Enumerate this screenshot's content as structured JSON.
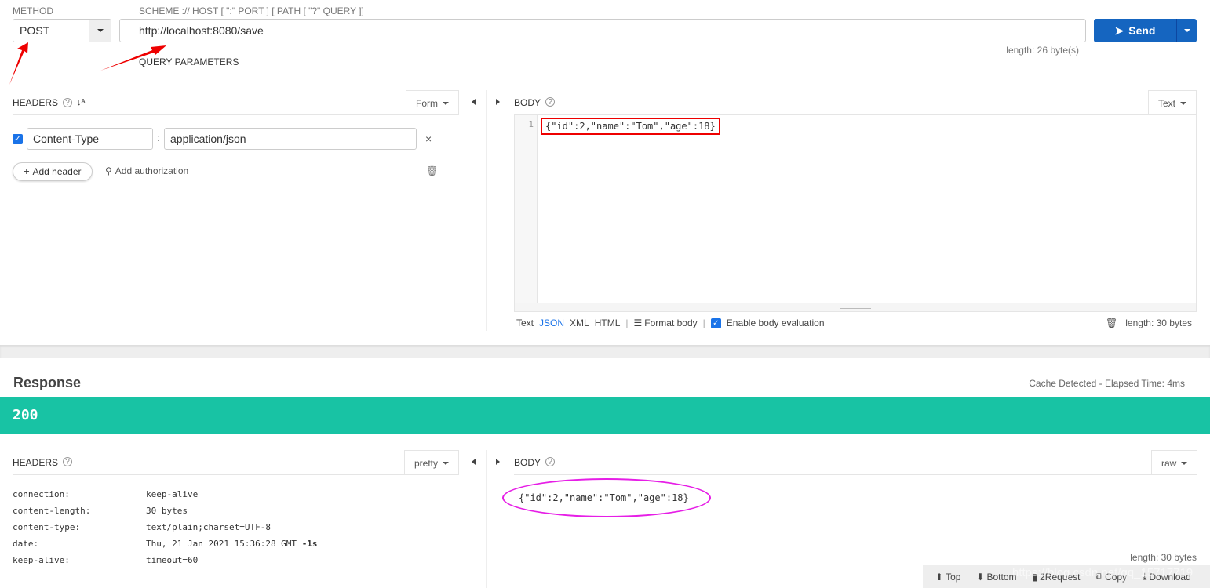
{
  "request": {
    "method_label": "METHOD",
    "method": "POST",
    "url_label": "SCHEME :// HOST [ \":\" PORT ] [ PATH [ \"?\" QUERY ]]",
    "url": "http://localhost:8080/save",
    "send_label": "Send",
    "url_length": "length: 26 byte(s)",
    "query_params": "QUERY PARAMETERS"
  },
  "req_headers": {
    "title": "HEADERS",
    "mode": "Form",
    "rows": [
      {
        "name": "Content-Type",
        "value": "application/json",
        "checked": true
      }
    ],
    "add_header": "Add header",
    "add_auth": "Add authorization"
  },
  "req_body": {
    "title": "BODY",
    "mode": "Text",
    "line_no": "1",
    "content": "{\"id\":2,\"name\":\"Tom\",\"age\":18}",
    "formats": [
      "Text",
      "JSON",
      "XML",
      "HTML"
    ],
    "format_body": "Format body",
    "enable_eval": "Enable body evaluation",
    "length": "length: 30 bytes"
  },
  "response": {
    "title": "Response",
    "elapsed": "Cache Detected - Elapsed Time: 4ms",
    "status": "200",
    "status_color": "#18c3a4",
    "headers_title": "HEADERS",
    "headers_mode": "pretty",
    "headers": [
      {
        "k": "connection:",
        "v": "keep-alive"
      },
      {
        "k": "content-length:",
        "v": "30 bytes"
      },
      {
        "k": "content-type:",
        "v": "text/plain;charset=UTF-8"
      },
      {
        "k": "date:",
        "v": "Thu, 21 Jan 2021 15:36:28 GMT",
        "extra": "-1s"
      },
      {
        "k": "keep-alive:",
        "v": "timeout=60"
      }
    ],
    "body_title": "BODY",
    "body_mode": "raw",
    "body": "{\"id\":2,\"name\":\"Tom\",\"age\":18}",
    "length": "length: 30 bytes"
  },
  "footer": {
    "top": "Top",
    "bottom": "Bottom",
    "to_request": "2Request",
    "copy": "Copy",
    "download": "Download"
  },
  "watermark": "https://blog.csdn.net/qq_15717719"
}
